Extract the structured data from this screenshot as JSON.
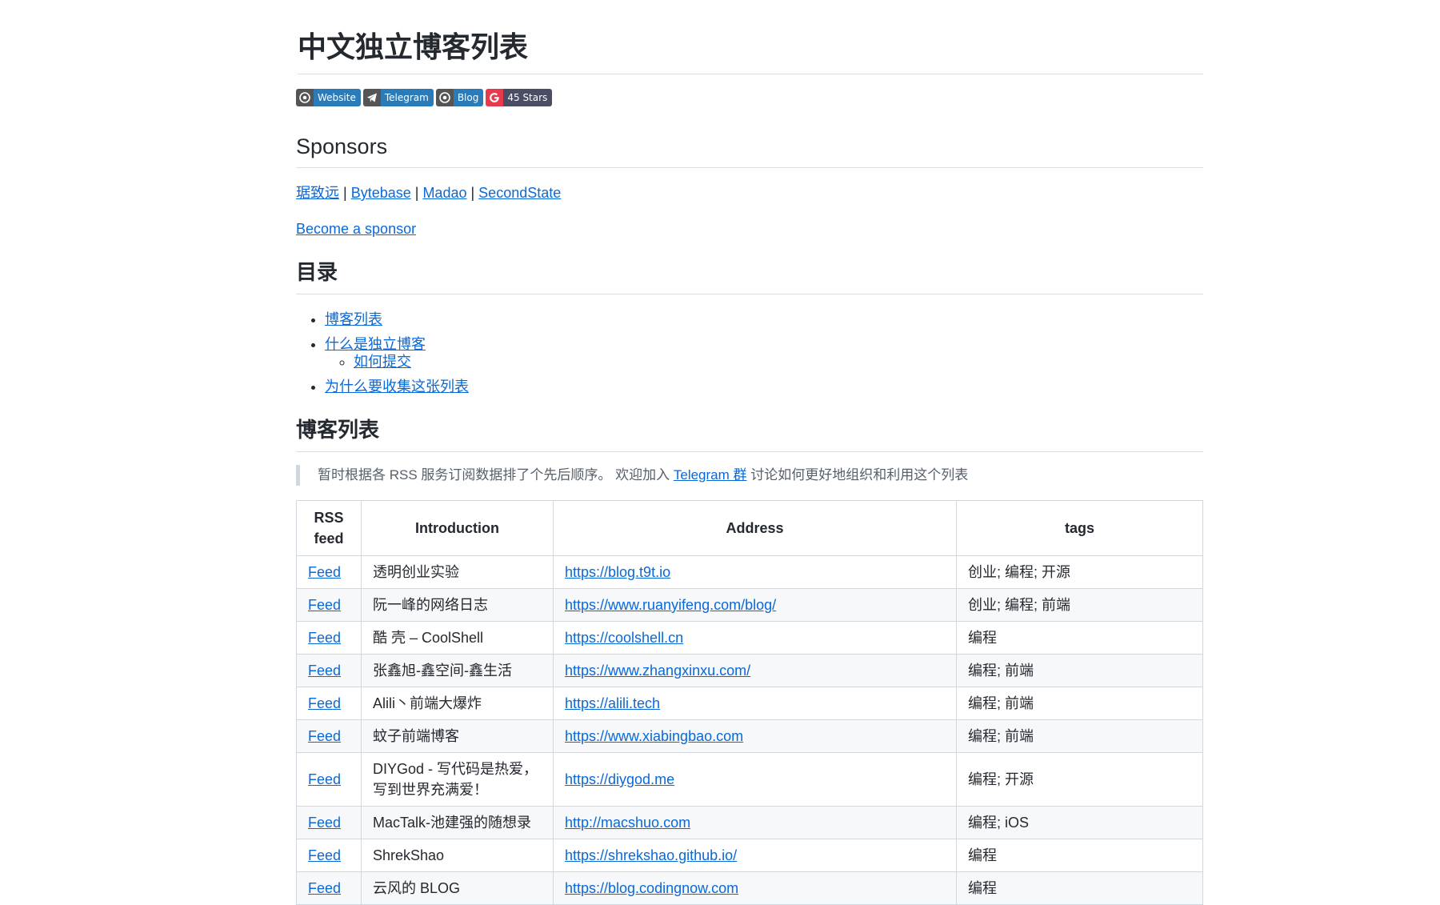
{
  "title": "中文独立博客列表",
  "badges": [
    {
      "icon": "chrome-icon",
      "label": "Website"
    },
    {
      "icon": "telegram-icon",
      "label": "Telegram"
    },
    {
      "icon": "chrome-icon",
      "label": "Blog"
    },
    {
      "icon": "google-icon",
      "label": "45 Stars"
    }
  ],
  "sponsors": {
    "heading": "Sponsors",
    "links": [
      "琚致远",
      "Bytebase",
      "Madao",
      "SecondState"
    ],
    "separator": " | ",
    "become": "Become a sponsor"
  },
  "toc": {
    "heading": "目录",
    "items": [
      "博客列表",
      "什么是独立博客",
      "如何提交",
      "为什么要收集这张列表"
    ]
  },
  "blog_list": {
    "heading": "博客列表",
    "note_prefix": "暂时根据各 RSS 服务订阅数据排了个先后顺序。 欢迎加入 ",
    "note_link": "Telegram 群",
    "note_suffix": " 讨论如何更好地组织和利用这个列表"
  },
  "table": {
    "headers": [
      "RSS feed",
      "Introduction",
      "Address",
      "tags"
    ],
    "rows": [
      {
        "feed": "Feed",
        "intro": "透明创业实验",
        "address": "https://blog.t9t.io",
        "tags": "创业; 编程; 开源"
      },
      {
        "feed": "Feed",
        "intro": "阮一峰的网络日志",
        "address": "https://www.ruanyifeng.com/blog/",
        "tags": "创业; 编程; 前端"
      },
      {
        "feed": "Feed",
        "intro": "酷 壳 – CoolShell",
        "address": "https://coolshell.cn",
        "tags": "编程"
      },
      {
        "feed": "Feed",
        "intro": "张鑫旭-鑫空间-鑫生活",
        "address": "https://www.zhangxinxu.com/",
        "tags": "编程; 前端"
      },
      {
        "feed": "Feed",
        "intro": "Alili丶前端大爆炸",
        "address": "https://alili.tech",
        "tags": "编程; 前端"
      },
      {
        "feed": "Feed",
        "intro": "蚊子前端博客",
        "address": "https://www.xiabingbao.com",
        "tags": "编程; 前端"
      },
      {
        "feed": "Feed",
        "intro": "DIYGod - 写代码是热爱，写到世界充满爱！",
        "address": "https://diygod.me",
        "tags": "编程; 开源"
      },
      {
        "feed": "Feed",
        "intro": "MacTalk-池建强的随想录",
        "address": "http://macshuo.com",
        "tags": "编程; iOS"
      },
      {
        "feed": "Feed",
        "intro": "ShrekShao",
        "address": "https://shrekshao.github.io/",
        "tags": "编程"
      },
      {
        "feed": "Feed",
        "intro": "云风的 BLOG",
        "address": "https://blog.codingnow.com",
        "tags": "编程"
      }
    ]
  }
}
